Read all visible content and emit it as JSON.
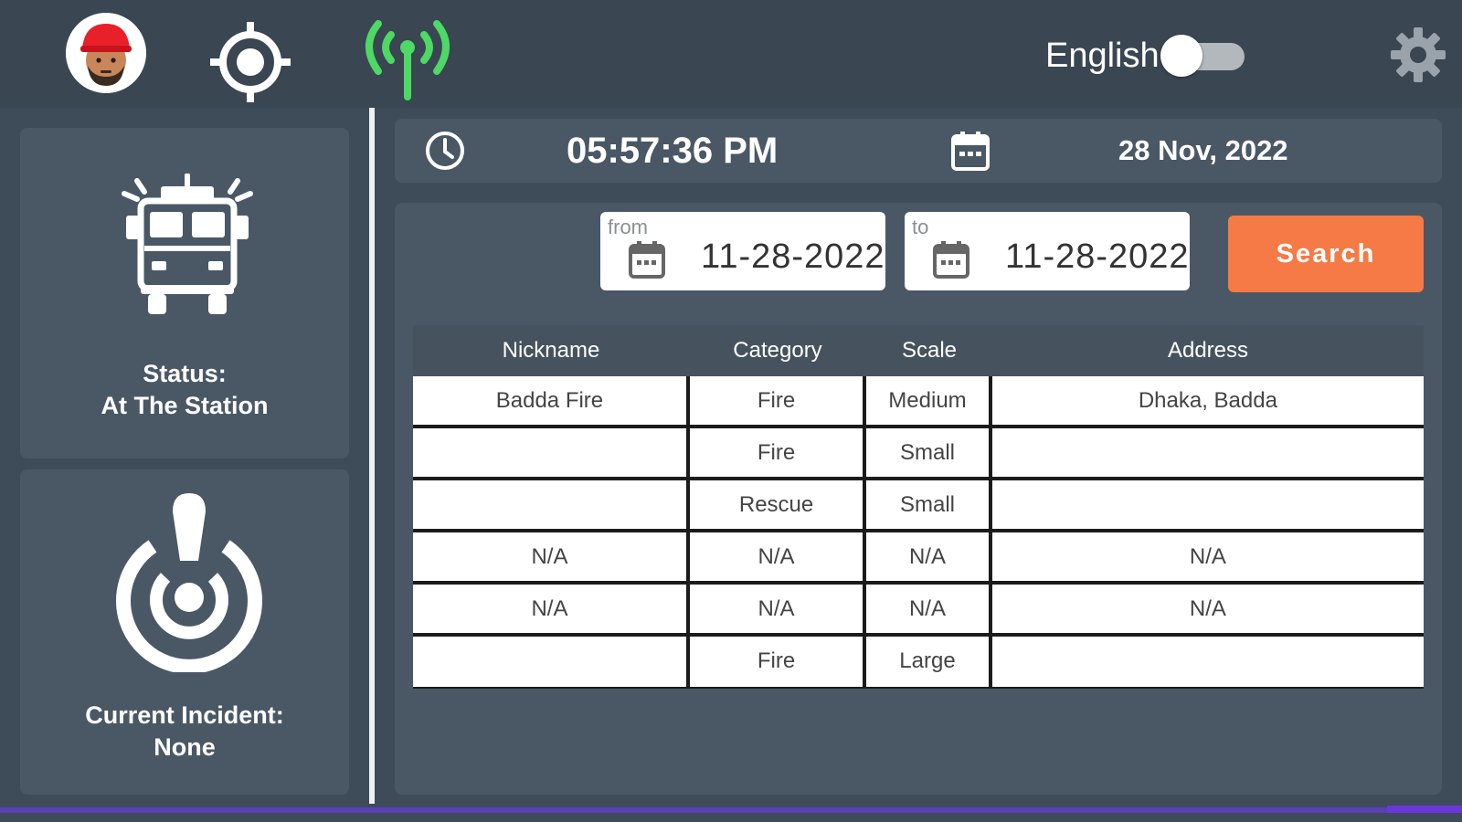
{
  "header": {
    "avatar_icon": "firefighter-avatar",
    "location_icon": "gps-target-icon",
    "signal_icon": "antenna-signal-icon",
    "signal_color": "#4cd964",
    "language_label": "English",
    "language_toggle_on": false,
    "settings_icon": "gear-icon"
  },
  "sidebar": {
    "status": {
      "icon": "fire-truck-icon",
      "line1": "Status:",
      "line2": "At The Station"
    },
    "incident": {
      "icon": "power-alert-icon",
      "line1": "Current Incident:",
      "line2": "None"
    }
  },
  "timebar": {
    "time": "05:57:36 PM",
    "date": "28 Nov, 2022"
  },
  "search": {
    "from_label": "from",
    "from_value": "11-28-2022",
    "to_label": "to",
    "to_value": "11-28-2022",
    "button_label": "Search",
    "button_color": "#f57a45"
  },
  "table": {
    "headers": [
      "Nickname",
      "Category",
      "Scale",
      "Address"
    ],
    "rows": [
      [
        "Badda Fire",
        "Fire",
        "Medium",
        "Dhaka, Badda"
      ],
      [
        "",
        "Fire",
        "Small",
        ""
      ],
      [
        "",
        "Rescue",
        "Small",
        ""
      ],
      [
        "N/A",
        "N/A",
        "N/A",
        "N/A"
      ],
      [
        "N/A",
        "N/A",
        "N/A",
        "N/A"
      ],
      [
        "",
        "Fire",
        "Large",
        ""
      ]
    ]
  }
}
